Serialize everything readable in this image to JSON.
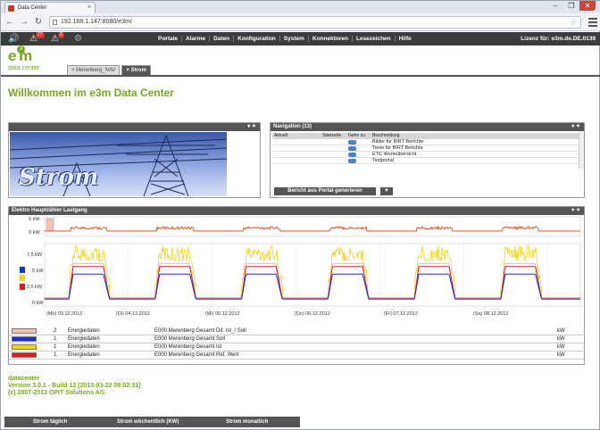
{
  "browser": {
    "tab_title": "Data Center",
    "tab_close": "×",
    "url": "192.168.1.147:8080/e3m/",
    "controls": [
      "–",
      "❐",
      "✕"
    ]
  },
  "appbar": {
    "alarm_badge_1": "17",
    "alarm_badge_2": "2",
    "menu": [
      "Portale",
      "Alarme",
      "Daten",
      "Konfiguration",
      "System",
      "Konnektoren",
      "Lesezeichen",
      "Hilfe"
    ],
    "license": "Lizenz für: e3m.de.DE.0139"
  },
  "logo": {
    "name": "e m",
    "superscript": "3",
    "sub": "data.center"
  },
  "subtabs": [
    "Merenberg_NAV",
    "Strom"
  ],
  "welcome": "Willkommen im e3m Data Center",
  "panel_strom": {
    "image_text": "Strom",
    "controls": "▾ ✦"
  },
  "panel_nav": {
    "title": "Navigation (13)",
    "controls": "▾ ✦",
    "columns": [
      "Aktuell",
      "Startseite",
      "Gehe zu",
      "Beschreibung"
    ],
    "rows": [
      "Bilder für BIRT Berichte",
      "Texte für BIRT Berichte",
      "ETC Werteübersicht",
      "Testportal"
    ],
    "button": "Bericht aus Portal generieren",
    "dropdown": "▼"
  },
  "panel_chart": {
    "title": "Elektro Hauptzähler Lastgang",
    "controls": "▾ ✦",
    "top_labels": [
      "5 kW",
      "0 kW"
    ],
    "main_labels": [
      "7,5 kW",
      "5 kW",
      "2,5 kW",
      "0 kW"
    ],
    "x_labels": [
      "(Mo) 03.12.2012",
      "(Di) 04.12.2012",
      "(Mi) 05.12.2012",
      "(Do) 06.12.2012",
      "(Fr) 07.12.2012",
      "(Sa) 08.12.2012"
    ],
    "legend": [
      {
        "n": "2",
        "type": "Energiedaten",
        "desc": "E000 Merenberg Gesamt Dif. Ist_/ Soll",
        "color": "#f3c0b4"
      },
      {
        "n": "1",
        "type": "Energiedaten",
        "desc": "E000 Merenberg Gesamt Soll",
        "color": "#1a2fd6"
      },
      {
        "n": "1",
        "type": "Energiedaten",
        "desc": "E000 Merenberg Gesamt Ist",
        "color": "#f2d21a"
      },
      {
        "n": "1",
        "type": "Energiedaten",
        "desc": "E000 Merenberg Gesamt Ref. Wert",
        "color": "#e01c1c"
      }
    ],
    "legend_action": "kW"
  },
  "footer": {
    "line1": "datacenter",
    "line2": "Version 3.0.1 - Build 12 [2013-03-22 09:02:31]",
    "line3": "(c) 2007-2013 OPIT Solutions AG"
  },
  "bottom_tabs": [
    "Strom täglich",
    "Strom wöchentlich (KW)",
    "Strom monatlich"
  ]
}
